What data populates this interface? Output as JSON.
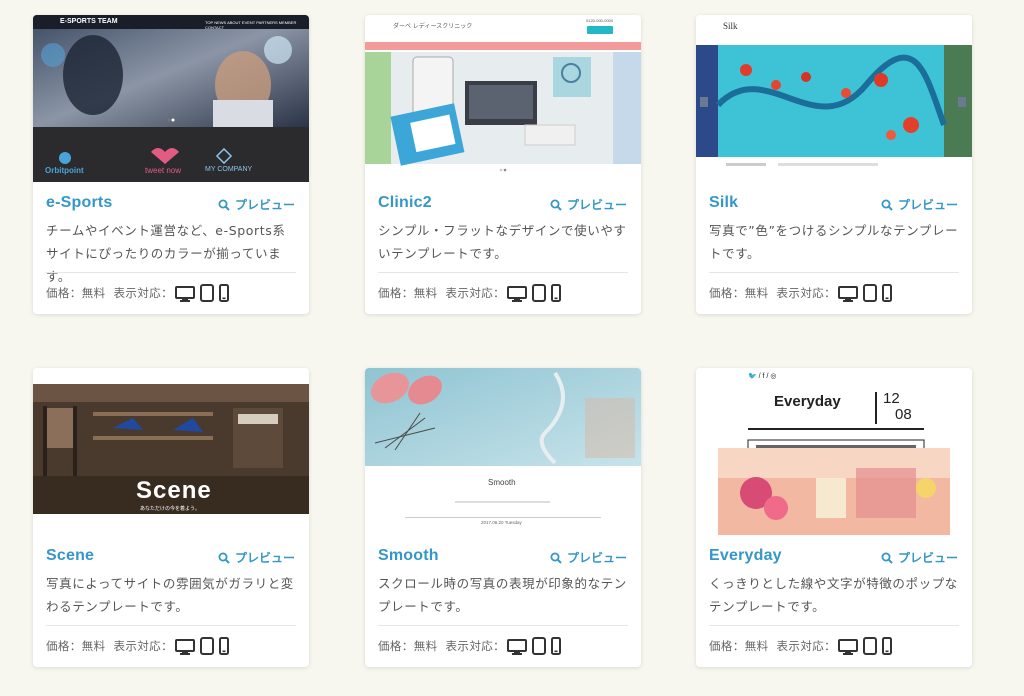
{
  "labels": {
    "preview": "プレビュー",
    "price_label": "価格：",
    "price_value": "無料",
    "display_label": "表示対応："
  },
  "accent_color": "#3597c7",
  "cards": [
    {
      "title": "e-Sports",
      "desc": "チームやイベント運営など、e-Sports系サイトにぴったりのカラーが揃っています。",
      "thumb": {
        "site_title": "E-SPORTS TEAM",
        "nav": "TOP  NEWS  ABOUT  EVENT  PARTNERS  MEMBER  CONTACT",
        "logo1": "Orbitpoint",
        "logo2": "tweet now",
        "logo3": "MY COMPANY"
      }
    },
    {
      "title": "Clinic2",
      "desc": "シンプル・フラットなデザインで使いやすいテンプレートです。",
      "thumb": {
        "site_title": "ダーベ レディースクリニック",
        "phone": "0120-000-0000"
      }
    },
    {
      "title": "Silk",
      "desc": "写真で”色”をつけるシンプルなテンプレートです。",
      "thumb": {
        "site_title": "Silk"
      }
    },
    {
      "title": "Scene",
      "desc": "写真によってサイトの雰囲気がガラリと変わるテンプレートです。",
      "thumb": {
        "hero_text": "Scene",
        "hero_sub": "あなただけの今を着よう。"
      }
    },
    {
      "title": "Smooth",
      "desc": "スクロール時の写真の表現が印象的なテンプレートです。",
      "thumb": {
        "site_title": "Smooth",
        "date": "2017.06.20 Tuesday"
      }
    },
    {
      "title": "Everyday",
      "desc": "くっきりとした線や文字が特徴のポップなテンプレートです。",
      "thumb": {
        "site_title": "Everyday",
        "date_top": "12",
        "date_bottom": "08"
      }
    }
  ]
}
